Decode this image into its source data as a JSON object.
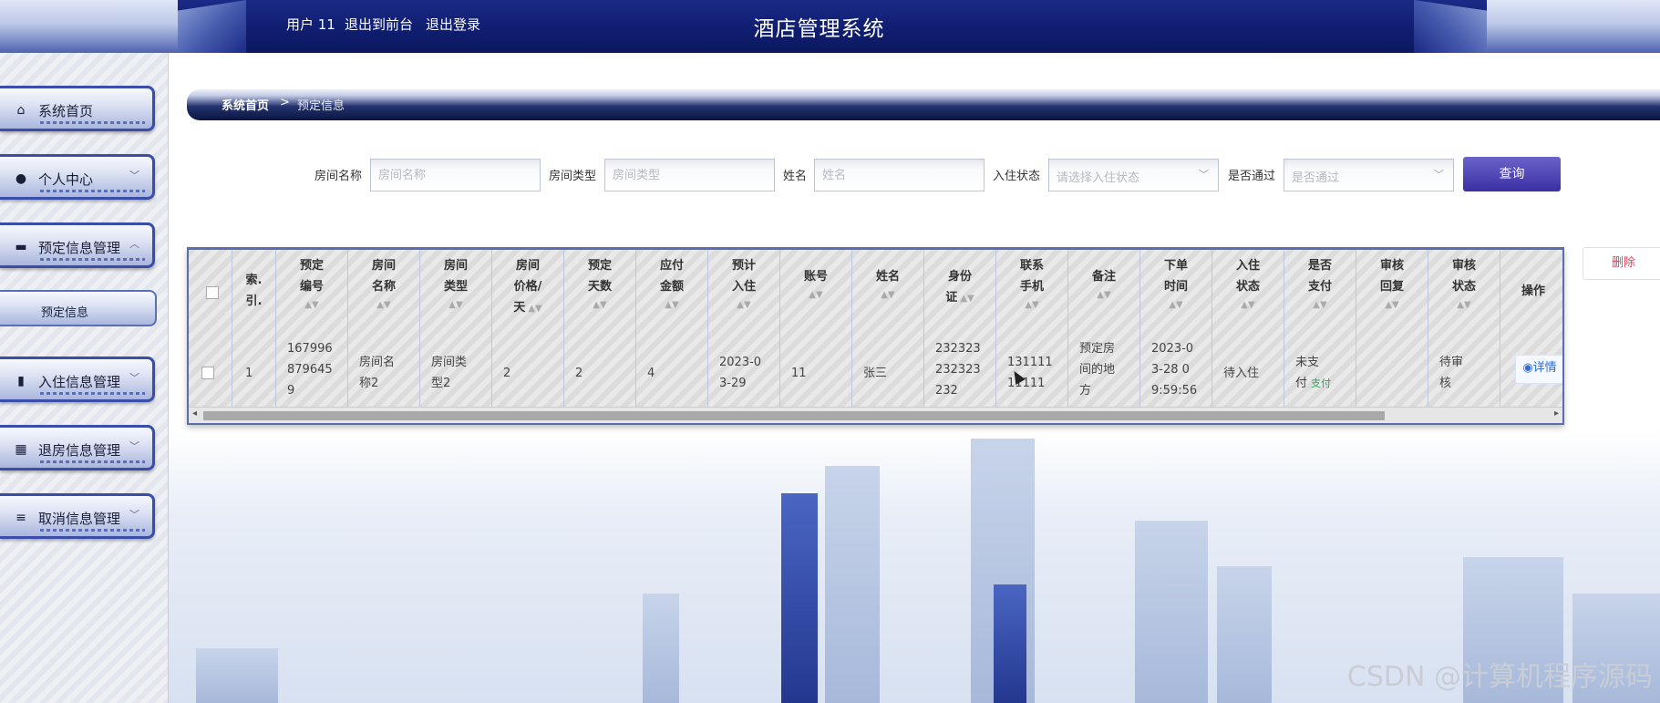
{
  "header": {
    "user_label": "用户 11",
    "to_front_label": "退出到前台",
    "logout_label": "退出登录",
    "title": "酒店管理系统"
  },
  "sidebar": {
    "items": [
      {
        "label": "系统首页",
        "icon": "home-icon"
      },
      {
        "label": "个人中心",
        "icon": "user-icon"
      },
      {
        "label": "预定信息管理",
        "icon": "monitor-icon"
      },
      {
        "label": "入住信息管理",
        "icon": "bar-chart-icon"
      },
      {
        "label": "退房信息管理",
        "icon": "grid-icon"
      },
      {
        "label": "取消信息管理",
        "icon": "list-icon"
      }
    ],
    "subitem": "预定信息"
  },
  "breadcrumb": {
    "home": "系统首页",
    "separator": ">",
    "current": "预定信息"
  },
  "search": {
    "room_name_label": "房间名称",
    "room_name_placeholder": "房间名称",
    "room_type_label": "房间类型",
    "room_type_placeholder": "房间类型",
    "name_label": "姓名",
    "name_placeholder": "姓名",
    "checkin_status_label": "入住状态",
    "checkin_status_placeholder": "请选择入住状态",
    "approved_label": "是否通过",
    "approved_placeholder": "是否通过",
    "query_label": "查询"
  },
  "actions": {
    "delete_label": "删除"
  },
  "table": {
    "headers": [
      "索.\n引.",
      "预定\n编号",
      "房间\n名称",
      "房间\n类型",
      "房间\n价格/\n天",
      "预定\n天数",
      "应付\n金额",
      "预计\n入住",
      "账号",
      "姓名",
      "身份\n证",
      "联系\n手机",
      "备注",
      "下单\n时间",
      "入住\n状态",
      "是否\n支付",
      "审核\n回复",
      "审核\n状态",
      "操作"
    ],
    "row": {
      "index": "1",
      "booking_no": "167996\n879645\n9",
      "room_name": "房间名\n称2",
      "room_type": "房间类\n型2",
      "price": "2",
      "days": "2",
      "amount": "4",
      "checkin_date": "2023-0\n3-29",
      "account": "11",
      "name": "张三",
      "id_card": "232323\n232323\n232",
      "phone": "131111\n11111",
      "remark": "预定房\n间的地\n方",
      "order_time": "2023-0\n3-28 0\n9:59:56",
      "checkin_status": "待入住",
      "paid": "未支\n付",
      "pay_link": "支付",
      "review_reply": "",
      "review_status": "待审\n核",
      "detail_label": "详情"
    }
  },
  "watermark": "CSDN @计算机程序源码",
  "colors": {
    "header_bg": "#0f1d6e",
    "query_button": "#3a2fa3",
    "delete_text": "#e0405a",
    "pay_link": "#29a659",
    "detail_link": "#2d6bd6"
  }
}
